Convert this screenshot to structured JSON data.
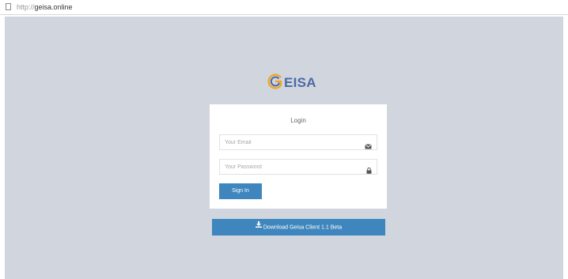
{
  "browser": {
    "url_scheme": "http://",
    "url_host": "geisa.online"
  },
  "logo": {
    "text": "EISA",
    "brand_color": "#4a6aa5",
    "accent_color": "#f2a51f",
    "icon": "geisa-g-logo-icon"
  },
  "login": {
    "title": "Login",
    "email_placeholder": "Your Email",
    "email_value": "",
    "email_icon": "envelope-icon",
    "password_placeholder": "Your Password",
    "password_value": "",
    "password_icon": "lock-icon",
    "signin_label": "Sign In"
  },
  "download": {
    "label": "Download Geisa Client 1.1 Beta",
    "icon": "download-icon"
  },
  "colors": {
    "page_background": "#d1d5dd",
    "button": "#3e86bd",
    "card": "#ffffff"
  }
}
